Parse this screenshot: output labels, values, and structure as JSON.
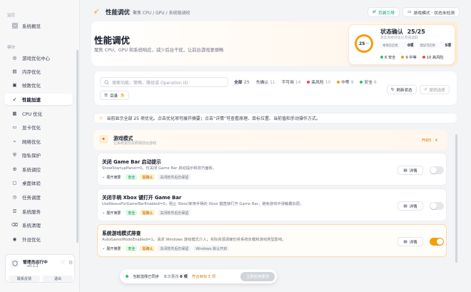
{
  "sidebar": {
    "group_monitor": "监控",
    "group_module": "模块",
    "items": [
      {
        "label": "系统概览",
        "icon": "grid-icon"
      },
      {
        "label": "游戏优化中心",
        "icon": "gamepad-icon"
      },
      {
        "label": "内存优化",
        "icon": "memory-icon"
      },
      {
        "label": "帧数优化",
        "icon": "frame-icon"
      },
      {
        "label": "性能加速",
        "icon": "rocket-icon"
      },
      {
        "label": "CPU 优化",
        "icon": "cpu-icon"
      },
      {
        "label": "显卡优化",
        "icon": "gpu-icon"
      },
      {
        "label": "网络优化",
        "icon": "network-icon"
      },
      {
        "label": "隐私保护",
        "icon": "privacy-icon"
      },
      {
        "label": "系统调控",
        "icon": "tune-icon"
      },
      {
        "label": "桌面体验",
        "icon": "desktop-icon"
      },
      {
        "label": "任务调度",
        "icon": "task-icon"
      },
      {
        "label": "系统服务",
        "icon": "service-icon"
      },
      {
        "label": "系统清理",
        "icon": "clean-icon"
      },
      {
        "label": "外设优化",
        "icon": "peripheral-icon"
      }
    ],
    "active_index": 4,
    "card": {
      "title": "管理员运行中",
      "version": "v0.1.2",
      "btn_feedback": "联系反馈",
      "btn_exit": "退出"
    }
  },
  "topbar": {
    "title": "性能调优",
    "breadcrumb": "聚焦 CPU / GPU / 系统级调校",
    "guide_label": "页面引导",
    "mode_label": "游戏模式 · 状态未检测"
  },
  "hero": {
    "title": "性能调优",
    "subtitle": "聚焦 CPU、GPU 和系统响应，减少后台干扰，让前台游戏更顺畅"
  },
  "status": {
    "title": "状态确认",
    "confirmed": "25/25",
    "ring_value": "25",
    "ring_total": "/25",
    "subtitle": "真实系统状态已完成读取",
    "applied_label": "本地已启用",
    "applied_value": "0项",
    "suggest_label": "建议可启用",
    "suggest_value": "5项",
    "legend_safe": "6 安全",
    "legend_mid": "9 中等",
    "legend_high": "10 高风险",
    "color_safe": "#22c55e",
    "color_mid": "#f59e0b",
    "color_high": "#ef4444"
  },
  "filter": {
    "search_placeholder": "搜索功能、策略、路径或 Operation ID",
    "tabs": [
      {
        "label": "全部",
        "count": "25"
      },
      {
        "label": "先确认",
        "count": "11"
      },
      {
        "label": "不可用",
        "count": "14"
      },
      {
        "label": "高风险",
        "count": "10"
      },
      {
        "label": "中等",
        "count": "9"
      },
      {
        "label": "安全",
        "count": "6"
      }
    ],
    "refresh_label": "刷新状态",
    "clear_label": "撤销选择",
    "dir_label": "目录",
    "dir_count": "5"
  },
  "notice": "当前显示全部 25 项优化。点击优化项可展开摘要；点击“详情”可查看原理、目标位置、当前值和手动操作方式。",
  "group": {
    "title": "游戏模式",
    "subtitle": "让系统更优先照顾前台游戏",
    "count": "开启5 · 4"
  },
  "items": [
    {
      "title": "关闭 Game Bar 启动提示",
      "desc": "ShowStartupPanel=0。仅关闭 Game Bar 启动提示和技巧面板。",
      "expand": "展开摘要",
      "tags": [
        "安全",
        "需确认",
        "关闭软件后仍保留"
      ],
      "detail": "详情",
      "enabled": false
    },
    {
      "title": "关闭手柄 Xbox 键打开 Game Bar",
      "desc": "UseNexusForGameBarEnabled=0。阻止 Xbox/家用手柄的 Xbox 键直接打开 Game Bar，避免游戏中误触叠加层。",
      "expand": "展开摘要",
      "tags": [
        "安全",
        "需确认",
        "关闭软件后仍保留"
      ],
      "detail": "详情",
      "enabled": false
    },
    {
      "title": "系统游戏模式排查",
      "desc": "AutoGameModeEnabled=1。请求 Windows 游戏模式介入；实际资源调度仍受系统负载和游戏类型影响。",
      "expand": "展开摘要",
      "tags": [
        "安全",
        "需确认",
        "关闭软件后仍保留",
        "Windows 默认开启"
      ],
      "detail": "详情",
      "enabled": true
    }
  ],
  "bottombar": {
    "sync_label": "当前选择已同步",
    "changes_label": "本次更改",
    "changes_value": "0 项",
    "pending_label": "符合目标 5 项",
    "apply_label": "立即应用更改"
  }
}
